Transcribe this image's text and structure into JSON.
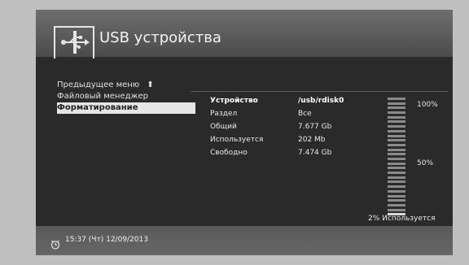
{
  "header": {
    "title": "USB устройства",
    "icon": "usb-icon"
  },
  "menu": {
    "items": [
      {
        "label": "Предыдущее меню",
        "icon": "arrow-up-icon"
      },
      {
        "label": "Файловый менеджер"
      },
      {
        "label": "Форматирование"
      }
    ],
    "selected_index": 2
  },
  "device_info": {
    "rows": [
      {
        "key": "Устройство",
        "value": "/usb/rdisk0"
      },
      {
        "key": "Раздел",
        "value": "Все"
      },
      {
        "key": "Общий",
        "value": "7.677 Gb"
      },
      {
        "key": "Используется",
        "value": "202 Mb"
      },
      {
        "key": "Свободно",
        "value": "7.474 Gb"
      }
    ]
  },
  "meter": {
    "label_top": "100%",
    "label_mid": "50%",
    "used_label": "2% Используется",
    "used_fraction": 0.02
  },
  "footer": {
    "icon": "clock-icon",
    "datetime": "15:37 (Чт) 12/09/2013"
  }
}
